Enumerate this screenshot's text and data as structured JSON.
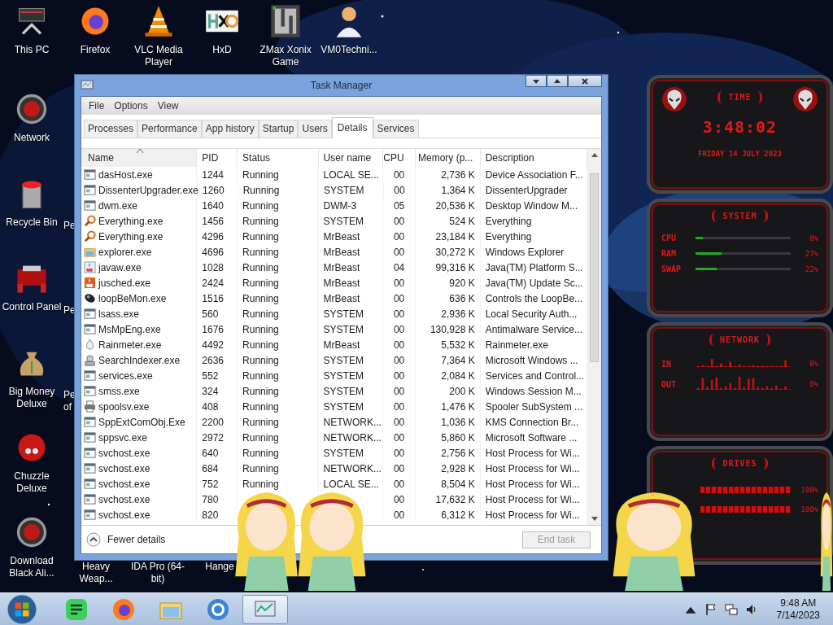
{
  "desktop": {
    "top_row": [
      {
        "label": "This PC",
        "kind": "monitor"
      },
      {
        "label": "Firefox",
        "kind": "firefox"
      },
      {
        "label": "VLC Media Player",
        "kind": "cone"
      },
      {
        "label": "HxD",
        "kind": "hex"
      },
      {
        "label": "ZMax Xonix Game",
        "kind": "maze"
      },
      {
        "label": "VM0Techni...",
        "kind": "doctor"
      }
    ],
    "left_column": [
      {
        "label": "Network",
        "kind": "orb"
      },
      {
        "label": "Recycle Bin",
        "kind": "bin",
        "beside": [
          "Pe"
        ]
      },
      {
        "label": "Control Panel",
        "kind": "panel",
        "beside": [
          "Pe"
        ]
      },
      {
        "label": "Big Money Deluxe",
        "kind": "moneybag",
        "beside": [
          "Pe",
          "of"
        ]
      },
      {
        "label": "Chuzzle Deluxe",
        "kind": "fuzzball"
      },
      {
        "label": "Download Black Ali...",
        "kind": "orb"
      }
    ],
    "bottom_labels": [
      "Heavy Weap...",
      "IDA Pro (64-bit)",
      "Hange"
    ]
  },
  "window": {
    "title": "Task Manager",
    "menu": [
      "File",
      "Options",
      "View"
    ],
    "tabs": [
      {
        "label": "Processes",
        "selected": false
      },
      {
        "label": "Performance",
        "selected": false
      },
      {
        "label": "App history",
        "selected": false
      },
      {
        "label": "Startup",
        "selected": false
      },
      {
        "label": "Users",
        "selected": false
      },
      {
        "label": "Details",
        "selected": true
      },
      {
        "label": "Services",
        "selected": false
      }
    ],
    "table": {
      "columns": [
        "Name",
        "PID",
        "Status",
        "User name",
        "CPU",
        "Memory (p...",
        "Description"
      ],
      "rows": [
        {
          "kind": "app",
          "name": "dasHost.exe",
          "pid": "1244",
          "status": "Running",
          "user": "LOCAL SE...",
          "cpu": "00",
          "memory": "2,736 K",
          "description": "Device Association F..."
        },
        {
          "kind": "app",
          "name": "DissenterUpgrader.exe",
          "pid": "1260",
          "status": "Running",
          "user": "SYSTEM",
          "cpu": "00",
          "memory": "1,364 K",
          "description": "DissenterUpgrader"
        },
        {
          "kind": "app",
          "name": "dwm.exe",
          "pid": "1640",
          "status": "Running",
          "user": "DWM-3",
          "cpu": "05",
          "memory": "20,536 K",
          "description": "Desktop Window M..."
        },
        {
          "kind": "magnifier",
          "name": "Everything.exe",
          "pid": "1456",
          "status": "Running",
          "user": "SYSTEM",
          "cpu": "00",
          "memory": "524 K",
          "description": "Everything"
        },
        {
          "kind": "magnifier",
          "name": "Everything.exe",
          "pid": "4296",
          "status": "Running",
          "user": "MrBeast",
          "cpu": "00",
          "memory": "23,184 K",
          "description": "Everything"
        },
        {
          "kind": "explorer",
          "name": "explorer.exe",
          "pid": "4696",
          "status": "Running",
          "user": "MrBeast",
          "cpu": "00",
          "memory": "30,272 K",
          "description": "Windows Explorer"
        },
        {
          "kind": "java",
          "name": "javaw.exe",
          "pid": "1028",
          "status": "Running",
          "user": "MrBeast",
          "cpu": "04",
          "memory": "99,316 K",
          "description": "Java(TM) Platform S..."
        },
        {
          "kind": "javaupdate",
          "name": "jusched.exe",
          "pid": "2424",
          "status": "Running",
          "user": "MrBeast",
          "cpu": "00",
          "memory": "920 K",
          "description": "Java(TM) Update Sc..."
        },
        {
          "kind": "loopbe",
          "name": "loopBeMon.exe",
          "pid": "1516",
          "status": "Running",
          "user": "MrBeast",
          "cpu": "00",
          "memory": "636 K",
          "description": "Controls the LoopBe..."
        },
        {
          "kind": "app",
          "name": "lsass.exe",
          "pid": "560",
          "status": "Running",
          "user": "SYSTEM",
          "cpu": "00",
          "memory": "2,936 K",
          "description": "Local Security Auth..."
        },
        {
          "kind": "app",
          "name": "MsMpEng.exe",
          "pid": "1676",
          "status": "Running",
          "user": "SYSTEM",
          "cpu": "00",
          "memory": "130,928 K",
          "description": "Antimalware Service..."
        },
        {
          "kind": "drop",
          "name": "Rainmeter.exe",
          "pid": "4492",
          "status": "Running",
          "user": "MrBeast",
          "cpu": "00",
          "memory": "5,532 K",
          "description": "Rainmeter.exe"
        },
        {
          "kind": "searchindexer",
          "name": "SearchIndexer.exe",
          "pid": "2636",
          "status": "Running",
          "user": "SYSTEM",
          "cpu": "00",
          "memory": "7,364 K",
          "description": "Microsoft Windows ..."
        },
        {
          "kind": "app",
          "name": "services.exe",
          "pid": "552",
          "status": "Running",
          "user": "SYSTEM",
          "cpu": "00",
          "memory": "2,084 K",
          "description": "Services and Control..."
        },
        {
          "kind": "app",
          "name": "smss.exe",
          "pid": "324",
          "status": "Running",
          "user": "SYSTEM",
          "cpu": "00",
          "memory": "200 K",
          "description": "Windows Session M..."
        },
        {
          "kind": "printer",
          "name": "spoolsv.exe",
          "pid": "408",
          "status": "Running",
          "user": "SYSTEM",
          "cpu": "00",
          "memory": "1,476 K",
          "description": "Spooler SubSystem ..."
        },
        {
          "kind": "app",
          "name": "SppExtComObj.Exe",
          "pid": "2200",
          "status": "Running",
          "user": "NETWORK...",
          "cpu": "00",
          "memory": "1,036 K",
          "description": "KMS Connection Br..."
        },
        {
          "kind": "app",
          "name": "sppsvc.exe",
          "pid": "2972",
          "status": "Running",
          "user": "NETWORK...",
          "cpu": "00",
          "memory": "5,860 K",
          "description": "Microsoft Software ..."
        },
        {
          "kind": "app",
          "name": "svchost.exe",
          "pid": "640",
          "status": "Running",
          "user": "SYSTEM",
          "cpu": "00",
          "memory": "2,756 K",
          "description": "Host Process for Wi..."
        },
        {
          "kind": "app",
          "name": "svchost.exe",
          "pid": "684",
          "status": "Running",
          "user": "NETWORK...",
          "cpu": "00",
          "memory": "2,928 K",
          "description": "Host Process for Wi..."
        },
        {
          "kind": "app",
          "name": "svchost.exe",
          "pid": "752",
          "status": "Running",
          "user": "LOCAL SE...",
          "cpu": "00",
          "memory": "8,504 K",
          "description": "Host Process for Wi..."
        },
        {
          "kind": "app",
          "name": "svchost.exe",
          "pid": "780",
          "cpu": "00",
          "memory": "17,632 K",
          "description": "Host Process for Wi..."
        },
        {
          "kind": "app",
          "name": "svchost.exe",
          "pid": "820",
          "cpu": "00",
          "memory": "6,312 K",
          "description": "Host Process for Wi..."
        }
      ]
    },
    "fewer_details": "Fewer details",
    "end_task": {
      "label": "End task",
      "disabled": true
    }
  },
  "widgets": {
    "time": {
      "title": "TIME",
      "clock": "3:48:02",
      "date": "FRIDAY 14 JULY 2023"
    },
    "system": {
      "title": "SYSTEM",
      "meters": [
        {
          "name": "CPU",
          "level": 0.08,
          "reading": "8%"
        },
        {
          "name": "RAM",
          "level": 0.27,
          "reading": "27%"
        },
        {
          "name": "SWAP",
          "level": 0.22,
          "reading": "22%"
        }
      ]
    },
    "network": {
      "title": "NETWORK",
      "lines": [
        {
          "name": "IN",
          "reading": "0%"
        },
        {
          "name": "OUT",
          "reading": "0%"
        }
      ]
    },
    "drives": {
      "title": "DRIVES",
      "bars": [
        {
          "level": 1,
          "reading": "100%"
        },
        {
          "level": 1,
          "reading": "100%"
        }
      ]
    }
  },
  "taskbar": {
    "apps": [
      {
        "kind": "notes",
        "selected": false
      },
      {
        "kind": "firefox",
        "selected": false
      },
      {
        "kind": "folder",
        "selected": false
      },
      {
        "kind": "chrome",
        "selected": false
      },
      {
        "kind": "taskmgr",
        "selected": true
      }
    ],
    "time": "9:48 AM",
    "date": "7/14/2023"
  }
}
